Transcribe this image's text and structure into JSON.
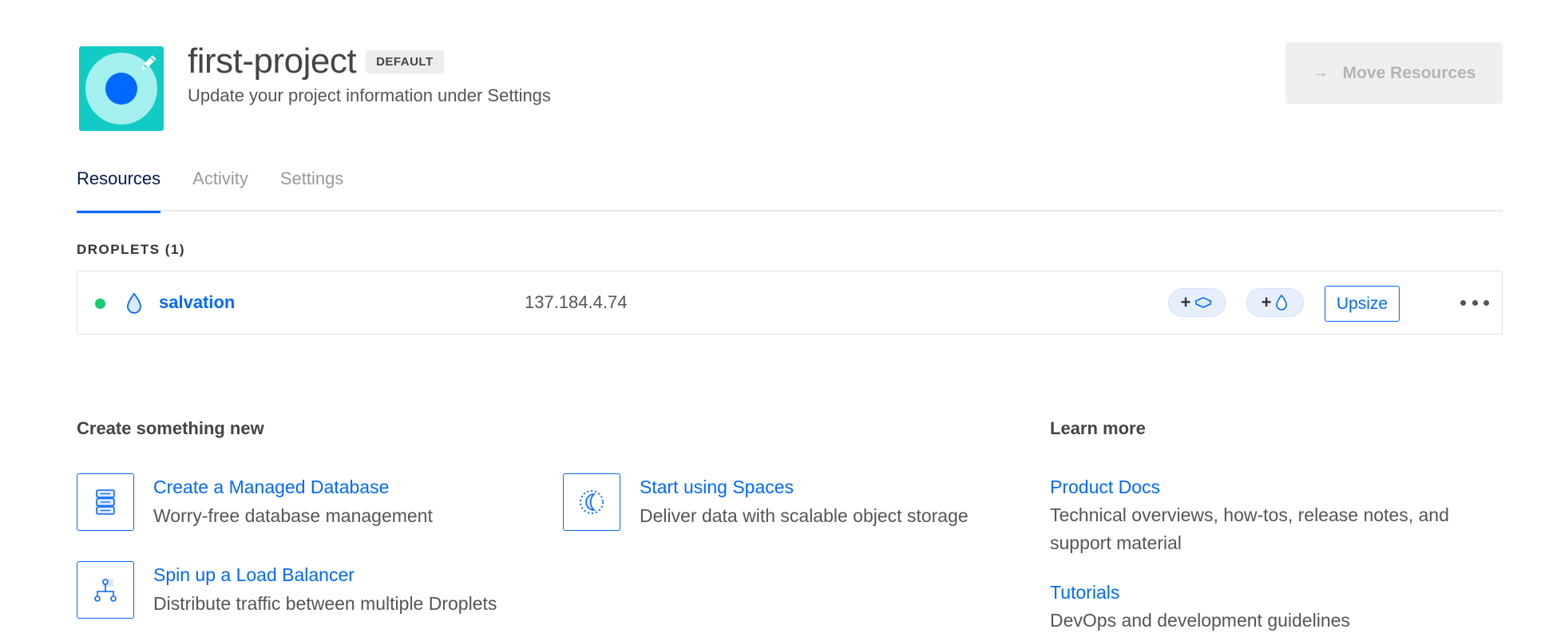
{
  "header": {
    "project_name": "first-project",
    "badge": "DEFAULT",
    "subtitle": "Update your project information under Settings",
    "move_button": "Move Resources",
    "move_button_icon": "arrow-right-icon"
  },
  "tabs": [
    {
      "label": "Resources",
      "active": true
    },
    {
      "label": "Activity",
      "active": false
    },
    {
      "label": "Settings",
      "active": false
    }
  ],
  "droplets": {
    "section_label": "DROPLETS (1)",
    "rows": [
      {
        "status_color": "#15cd72",
        "name": "salvation",
        "ip": "137.184.4.74",
        "add_volume_icon": "volume-icon",
        "add_droplet_icon": "droplet-icon",
        "upsize_label": "Upsize"
      }
    ]
  },
  "create": {
    "heading": "Create something new",
    "items": [
      {
        "icon": "database-icon",
        "title": "Create a Managed Database",
        "description": "Worry-free database management"
      },
      {
        "icon": "spaces-icon",
        "title": "Start using Spaces",
        "description": "Deliver data with scalable object storage"
      },
      {
        "icon": "load-balancer-icon",
        "title": "Spin up a Load Balancer",
        "description": "Distribute traffic between multiple Droplets"
      }
    ]
  },
  "learn": {
    "heading": "Learn more",
    "items": [
      {
        "title": "Product Docs",
        "description": "Technical overviews, how-tos, release notes, and support material"
      },
      {
        "title": "Tutorials",
        "description": "DevOps and development guidelines"
      }
    ]
  },
  "colors": {
    "accent": "#0069ff",
    "project_icon_bg": "#12cbc4",
    "status_active": "#15cd72"
  }
}
